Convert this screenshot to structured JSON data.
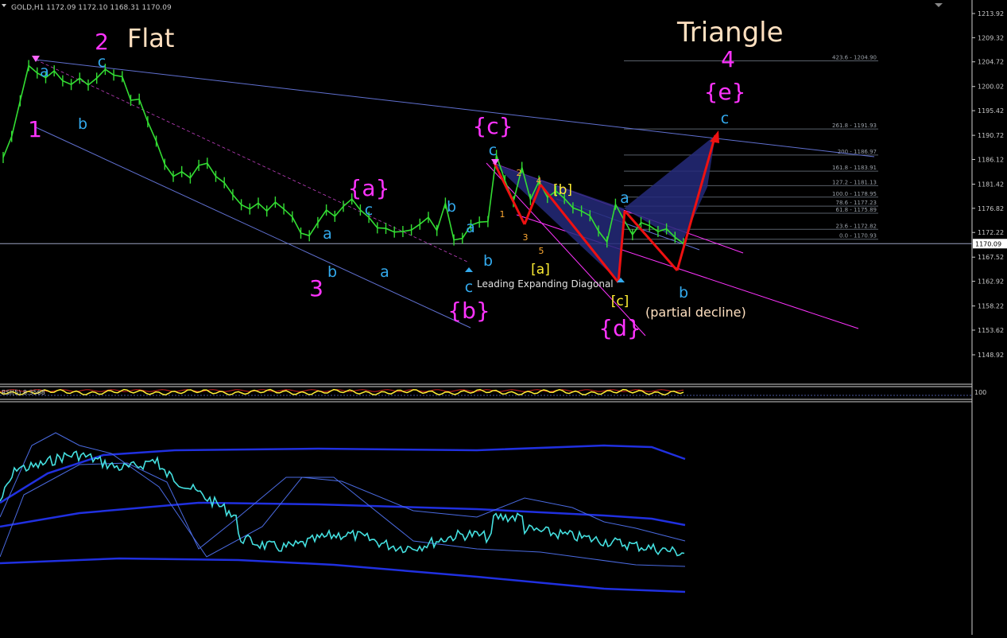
{
  "window": {
    "header": "GOLD,H1  1172.09 1172.10 1168.31 1170.09",
    "current_price": "1170.09"
  },
  "colors": {
    "background": "#000000",
    "candles": "#33dd33",
    "axis_text": "#c8c8c8",
    "wave_primary": "#ff33ff",
    "wave_minor": "#33aaee",
    "wave_sub": "#ffee33",
    "title_text": "#ffe0c0",
    "forecast_arrow": "#ee1111",
    "triangle_fill": "#242a7a",
    "channel_line": "#6070d0",
    "rsi_line": "#ffee33",
    "indicator_line": "#44e0e0",
    "indicator_bands": "#2030e0"
  },
  "chart_data": {
    "type": "line",
    "title": "",
    "xlabel": "",
    "ylabel": "",
    "ylim": [
      1145,
      1216
    ],
    "grid": false,
    "y_ticks": [
      "1213.92",
      "1209.32",
      "1204.72",
      "1200.02",
      "1195.42",
      "1190.72",
      "1186.12",
      "1181.42",
      "1176.82",
      "1172.22",
      "1167.52",
      "1162.92",
      "1158.22",
      "1153.62",
      "1148.92"
    ],
    "series": [
      {
        "values": [
          1186.5,
          1190.5,
          1197.3,
          1204.0,
          1202.6,
          1201.7,
          1203.0,
          1201.1,
          1200.4,
          1201.6,
          1200.3,
          1201.6,
          1203.3,
          1202.2,
          1201.9,
          1197.4,
          1197.6,
          1193.3,
          1189.6,
          1185.2,
          1182.9,
          1183.8,
          1182.6,
          1185.0,
          1185.4,
          1182.9,
          1181.7,
          1179.4,
          1177.5,
          1176.7,
          1177.8,
          1176.3,
          1178.0,
          1176.7,
          1175.2,
          1172.1,
          1171.6,
          1174.1,
          1176.5,
          1175.3,
          1177.2,
          1178.6,
          1176.5,
          1175.1,
          1173.1,
          1173.0,
          1172.3,
          1172.4,
          1172.7,
          1173.8,
          1175.1,
          1172.6,
          1177.8,
          1170.8,
          1171.1,
          1173.6,
          1174.2,
          1174.3,
          1186.9,
          1182.1,
          1178.1,
          1184.6,
          1178.5,
          1182.0,
          1178.9,
          1180.1,
          1178.7,
          1176.9,
          1176.3,
          1175.4,
          1172.5,
          1170.4,
          1177.6,
          1174.6,
          1171.8,
          1174.1,
          1173.5,
          1172.4,
          1172.9,
          1171.3,
          1170.1
        ]
      }
    ],
    "fibonacci_levels": [
      "423.6 - 1204.90",
      "261.8 - 1191.93",
      "200 - 1186.97",
      "161.8 - 1183.91",
      "127.2 - 1181.13",
      "100.0 - 1178.95",
      "78.6 - 1177.23",
      "61.8 - 1175.89",
      "23.6 - 1172.82",
      "0.0 - 1170.93"
    ],
    "wave_labels": [
      {
        "text": "2",
        "role": "primary"
      },
      {
        "text": "1",
        "role": "primary"
      },
      {
        "text": "3",
        "role": "primary"
      },
      {
        "text": "4",
        "role": "primary"
      },
      {
        "text": "{a}",
        "role": "primary"
      },
      {
        "text": "{b}",
        "role": "primary"
      },
      {
        "text": "{c}",
        "role": "primary"
      },
      {
        "text": "{d}",
        "role": "primary"
      },
      {
        "text": "{e}",
        "role": "primary"
      },
      {
        "text": "a",
        "role": "minor"
      },
      {
        "text": "b",
        "role": "minor"
      },
      {
        "text": "c",
        "role": "minor"
      },
      {
        "text": "a",
        "role": "minor"
      },
      {
        "text": "b",
        "role": "minor"
      },
      {
        "text": "a",
        "role": "minor"
      },
      {
        "text": "c",
        "role": "minor"
      },
      {
        "text": "b",
        "role": "minor"
      },
      {
        "text": "a",
        "role": "minor"
      },
      {
        "text": "b",
        "role": "minor"
      },
      {
        "text": "c",
        "role": "minor"
      },
      {
        "text": "c",
        "role": "minor"
      },
      {
        "text": "a",
        "role": "minor"
      },
      {
        "text": "b",
        "role": "minor"
      },
      {
        "text": "c",
        "role": "minor"
      },
      {
        "text": "[a]",
        "role": "sub"
      },
      {
        "text": "[b]",
        "role": "sub"
      },
      {
        "text": "[c]",
        "role": "sub"
      },
      {
        "text": "1",
        "role": "count"
      },
      {
        "text": "2",
        "role": "count"
      },
      {
        "text": "3",
        "role": "count"
      },
      {
        "text": "4",
        "role": "count"
      },
      {
        "text": "5",
        "role": "count"
      }
    ],
    "annotations": {
      "flat": "Flat",
      "triangle": "Triangle",
      "diagonal": "Leading Expanding Diagonal",
      "partial": "(partial decline)"
    }
  },
  "rsi_panel": {
    "label": "RSI(5) 8.3568",
    "level_label": "100"
  }
}
